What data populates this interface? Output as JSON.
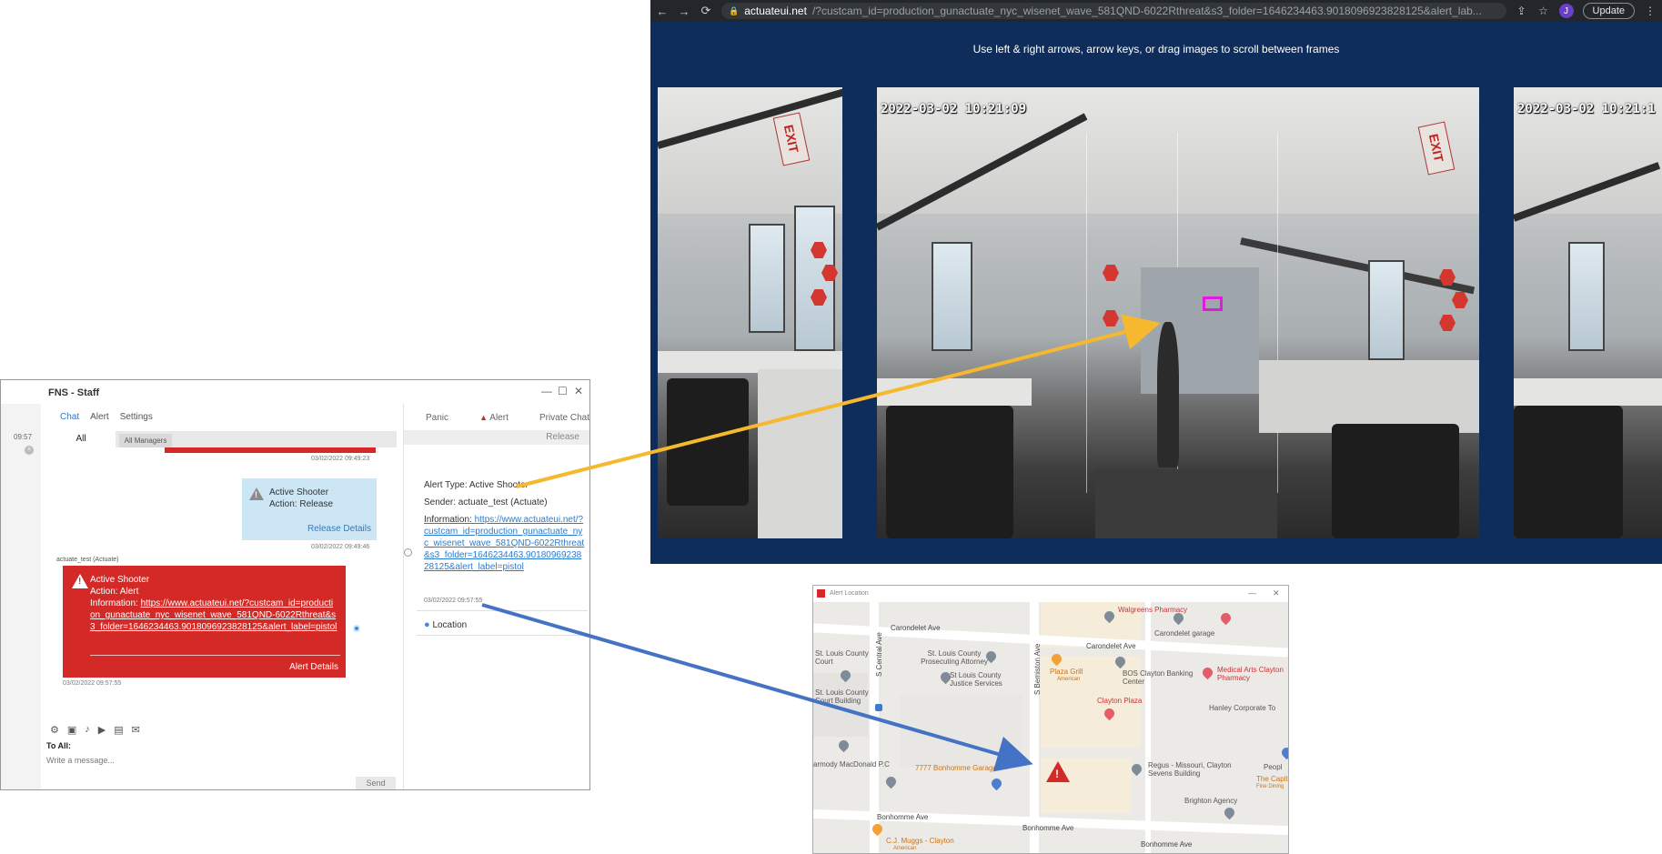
{
  "browser": {
    "url_host": "actuateui.net",
    "url_rest": "/?custcam_id=production_gunactuate_nyc_wisenet_wave_581QND-6022Rthreat&s3_folder=1646234463.9018096923828125&alert_lab...",
    "avatar_letter": "J",
    "update_label": "Update",
    "instructions": "Use left & right arrows, arrow keys, or drag images to scroll between frames",
    "frames": [
      {
        "timestamp": ""
      },
      {
        "timestamp": "2022-03-02 10:21:09"
      },
      {
        "timestamp": "2022-03-02 10:21:1"
      }
    ],
    "exit_sign": "EXIT"
  },
  "chat": {
    "title": "FNS - Staff",
    "side_time": "09:57",
    "tabs": {
      "chat": "Chat",
      "alert": "Alert",
      "settings": "Settings"
    },
    "subtabs": {
      "all": "All",
      "managers": "All Managers"
    },
    "messages": {
      "prev_ts": "03/02/2022 09:49:23",
      "release": {
        "line1": "Active Shooter",
        "line2": "Action: Release",
        "details": "Release Details",
        "ts": "03/02/2022 09:49:46"
      },
      "sender": "actuate_test (Actuate)",
      "alert": {
        "line1": "Active Shooter",
        "line2": "Action: Alert",
        "info_label": "Information: ",
        "link": "https://www.actuateui.net/?custcam_id=production_gunactuate_nyc_wisenet_wave_581QND-6022Rthreat&s3_folder=1646234463.9018096923828125&alert_label=pistol",
        "details": "Alert Details",
        "ts": "03/02/2022 09:57:55"
      }
    },
    "input": {
      "to_all": "To All:",
      "placeholder": "Write a message...",
      "send": "Send"
    },
    "right_panel": {
      "tabs": {
        "panic": "Panic",
        "alert": "Alert",
        "private": "Private Chat"
      },
      "release": "Release",
      "alert_type": "Alert Type: Active Shooter",
      "sender": "Sender: actuate_test (Actuate)",
      "info_label": "Information: ",
      "info_link": "https://www.actuateui.net/?custcam_id=production_gunactuate_nyc_wisenet_wave_581QND-6022Rthreat&s3_folder=1646234463.9018096923828125&alert_label=pistol",
      "ts": "03/02/2022 09:57:55",
      "location": "Location"
    }
  },
  "map": {
    "title": "Alert Location",
    "labels": {
      "walgreens": "Walgreens Pharmacy",
      "carondelet_ave_1": "Carondelet Ave",
      "carondelet_ave_2": "Carondelet Ave",
      "carondelet_garage": "Carondelet garage",
      "st_louis_county_court": "St. Louis County Court",
      "st_louis_pa": "St. Louis County Prosecuting Attorney",
      "justice": "St Louis County Justice Services",
      "court_building": "St. Louis County Court Building",
      "plaza_grill": "Plaza Grill",
      "plaza_grill_sub": "American",
      "bos": "BOS Clayton Banking Center",
      "medical_arts": "Medical Arts Clayton Pharmacy",
      "clayton_plaza": "Clayton Plaza",
      "hanley": "Hanley Corporate To",
      "regus": "Regus - Missouri, Clayton Sevens Building",
      "macdonald": "armody MacDonald P.C",
      "garage": "7777 Bonhomme Garage",
      "brighton": "Brighton Agency",
      "capital": "The Capital G",
      "capital_sub": "Fine Dining",
      "people": "Peopl",
      "bonhomme_1": "Bonhomme Ave",
      "bonhomme_2": "Bonhomme Ave",
      "bonhomme_3": "Bonhomme Ave",
      "cj_mugs": "C.J. Muggs - Clayton",
      "cj_mugs_sub": "American",
      "s_central": "S Central Ave",
      "s_bemiston": "S Bemiston Ave"
    }
  },
  "colors": {
    "alert_red": "#d42a27",
    "link_blue": "#2b7bd1",
    "browser_bg": "#0f2d5a",
    "arrow_yellow": "#f5b82e",
    "arrow_blue": "#4472c4",
    "detect_magenta": "#e11adf"
  }
}
